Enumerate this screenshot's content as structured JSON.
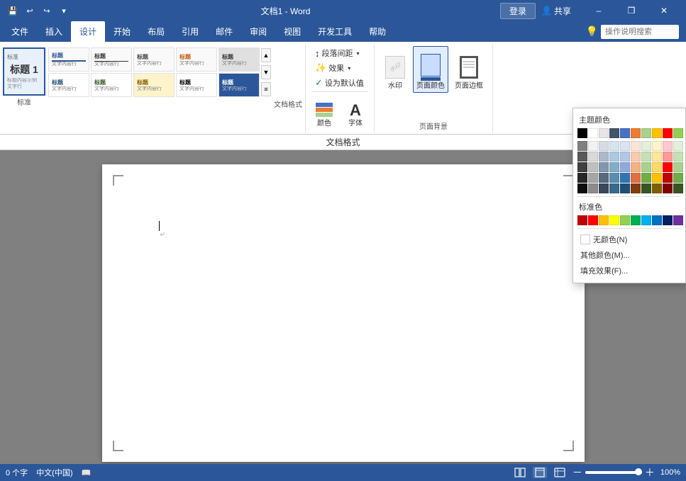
{
  "titlebar": {
    "title": "文档1 - Word",
    "login_label": "登录",
    "share_label": "共享"
  },
  "ribbon": {
    "tabs": [
      {
        "id": "file",
        "label": "文件"
      },
      {
        "id": "insert",
        "label": "插入"
      },
      {
        "id": "design",
        "label": "设计",
        "active": true
      },
      {
        "id": "layout",
        "label": "开始"
      },
      {
        "id": "pagel",
        "label": "布局"
      },
      {
        "id": "ref",
        "label": "引用"
      },
      {
        "id": "mail",
        "label": "邮件"
      },
      {
        "id": "review",
        "label": "审阅"
      },
      {
        "id": "view",
        "label": "视图"
      },
      {
        "id": "dev",
        "label": "开发工具"
      },
      {
        "id": "help",
        "label": "帮助"
      }
    ],
    "search_placeholder": "操作说明搜索",
    "style_gallery_label": "文档格式",
    "styles": [
      {
        "name": "标准",
        "selected": true,
        "label": "标题 1"
      },
      {
        "name": "标题",
        "label": "标题"
      },
      {
        "name": "标题2",
        "label": "标题"
      },
      {
        "name": "标题3",
        "label": "标题"
      },
      {
        "name": "标题4",
        "label": "标题"
      },
      {
        "name": "标题5",
        "label": "标题"
      }
    ],
    "colors_btn": "颜色",
    "fonts_btn": "字体",
    "spacing_btn": "段落间距",
    "effects_btn": "效果",
    "set_default_btn": "设为默认值",
    "watermark_btn": "水印",
    "page_color_btn": "页面颜色",
    "page_border_btn": "页面边框"
  },
  "doc_format_bar_label": "文档格式",
  "color_picker": {
    "theme_title": "主题颜色",
    "standard_title": "标准色",
    "no_color_label": "无颜色(N)",
    "more_colors_label": "其他颜色(M)...",
    "fill_effects_label": "填充效果(F)...",
    "theme_colors_row1": [
      "#000000",
      "#ffffff",
      "#e7e6e6",
      "#44546a",
      "#4472c4",
      "#ed7d31",
      "#a9d18e",
      "#ffc000",
      "#ff0000",
      "#92d050"
    ],
    "shade_rows": [
      [
        "#7f7f7f",
        "#f2f2f2",
        "#d6dce4",
        "#d6e4f0",
        "#dae3f3",
        "#fce4d6",
        "#e2efda",
        "#fff2cc",
        "#ffc7ce",
        "#e2efda"
      ],
      [
        "#595959",
        "#d9d9d9",
        "#adb9ca",
        "#adc8e3",
        "#b4c6e7",
        "#f8cbad",
        "#c6e0b4",
        "#ffe699",
        "#ff9999",
        "#c6e0b4"
      ],
      [
        "#3f3f3f",
        "#bfbfbf",
        "#8496af",
        "#82adc7",
        "#8ea9db",
        "#f4b183",
        "#a9d18e",
        "#ffd966",
        "#ff0000",
        "#a9d18e"
      ],
      [
        "#262626",
        "#a6a6a6",
        "#596a80",
        "#5c8db0",
        "#2e75b6",
        "#e07040",
        "#70ad47",
        "#ffc000",
        "#c00000",
        "#70ad47"
      ],
      [
        "#0d0d0d",
        "#8c8c8c",
        "#3a475c",
        "#3a6a8a",
        "#1f4e79",
        "#843c0c",
        "#375623",
        "#7f6000",
        "#820000",
        "#375623"
      ]
    ],
    "standard_colors": [
      "#c00000",
      "#ff0000",
      "#ffc000",
      "#ffff00",
      "#92d050",
      "#00b050",
      "#00b0f0",
      "#0070c0",
      "#002060",
      "#7030a0"
    ]
  },
  "statusbar": {
    "word_count": "0 个字",
    "language": "中文(中国)",
    "zoom_level": "100%"
  }
}
